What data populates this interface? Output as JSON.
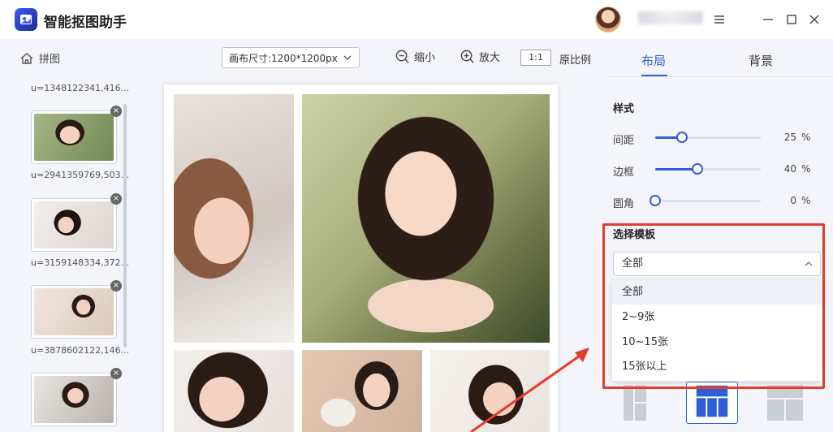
{
  "app": {
    "title": "智能抠图助手"
  },
  "toolbar": {
    "home_label": "拼图",
    "canvas_size": "画布尺寸:1200*1200px",
    "zoom_out_label": "缩小",
    "zoom_in_label": "放大",
    "ratio_box": "1:1",
    "original_ratio_label": "原比例"
  },
  "thumbnails": [
    {
      "caption": "u=1348122341,416..."
    },
    {
      "caption": "u=2941359769,503..."
    },
    {
      "caption": "u=3159148334,372..."
    },
    {
      "caption": "u=3878602122,146..."
    }
  ],
  "right_panel": {
    "tabs": [
      "布局",
      "背景"
    ],
    "active_tab": "布局",
    "style_title": "样式",
    "sliders": [
      {
        "label": "间距",
        "value": 25,
        "unit": "%",
        "fraction": 0.25
      },
      {
        "label": "边框",
        "value": 40,
        "unit": "%",
        "fraction": 0.4
      },
      {
        "label": "圆角",
        "value": 0,
        "unit": "%",
        "fraction": 0.0
      }
    ],
    "template_title": "选择模板",
    "template_selected": "全部",
    "template_options": [
      "全部",
      "2~9张",
      "10~15张",
      "15张以上"
    ]
  },
  "colors": {
    "accent": "#2f5fd6",
    "highlight": "#e53b2f"
  },
  "icons": [
    "app-logo-icon",
    "home-icon",
    "chevron-down-icon",
    "zoom-out-icon",
    "zoom-in-icon",
    "menu-icon",
    "minimize-icon",
    "maximize-icon",
    "close-icon",
    "chevron-up-icon"
  ]
}
